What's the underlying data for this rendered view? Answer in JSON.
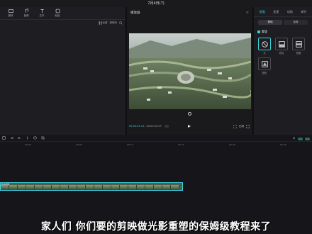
{
  "app": {
    "title": "7月4日(7)"
  },
  "media": {
    "tabs": [
      {
        "label": "媒体",
        "icon": "media-icon"
      },
      {
        "label": "音频",
        "icon": "audio-icon"
      },
      {
        "label": "文本",
        "icon": "text-icon"
      },
      {
        "label": "贴纸",
        "icon": "sticker-icon"
      }
    ],
    "toolbar": {
      "sort": "全部",
      "view": "按修改"
    }
  },
  "player": {
    "title": "播放器",
    "timecode_current": "00:00:01:12",
    "timecode_total": "00:00:10:07",
    "ratio_label": "比例"
  },
  "properties": {
    "tabs": [
      "画面",
      "变速",
      "动画",
      "调节"
    ],
    "subtabs": [
      "基础",
      "抠像"
    ],
    "section": "蒙版",
    "presets": [
      {
        "label": "无",
        "icon": "none-mask-icon"
      },
      {
        "label": "线性",
        "icon": "linear-mask-icon"
      },
      {
        "label": "镜面",
        "icon": "mirror-mask-icon"
      },
      {
        "label": "圆形",
        "icon": "circle-mask-icon"
      }
    ]
  },
  "timeline": {
    "ruler": [
      "00:00",
      "00:05",
      "00:10",
      "00:15",
      "00:20",
      "00:25",
      "00:30"
    ],
    "clip_label": "航拍视频"
  },
  "subtitle": "家人们 你们要的剪映做光影重塑的保姆级教程来了"
}
